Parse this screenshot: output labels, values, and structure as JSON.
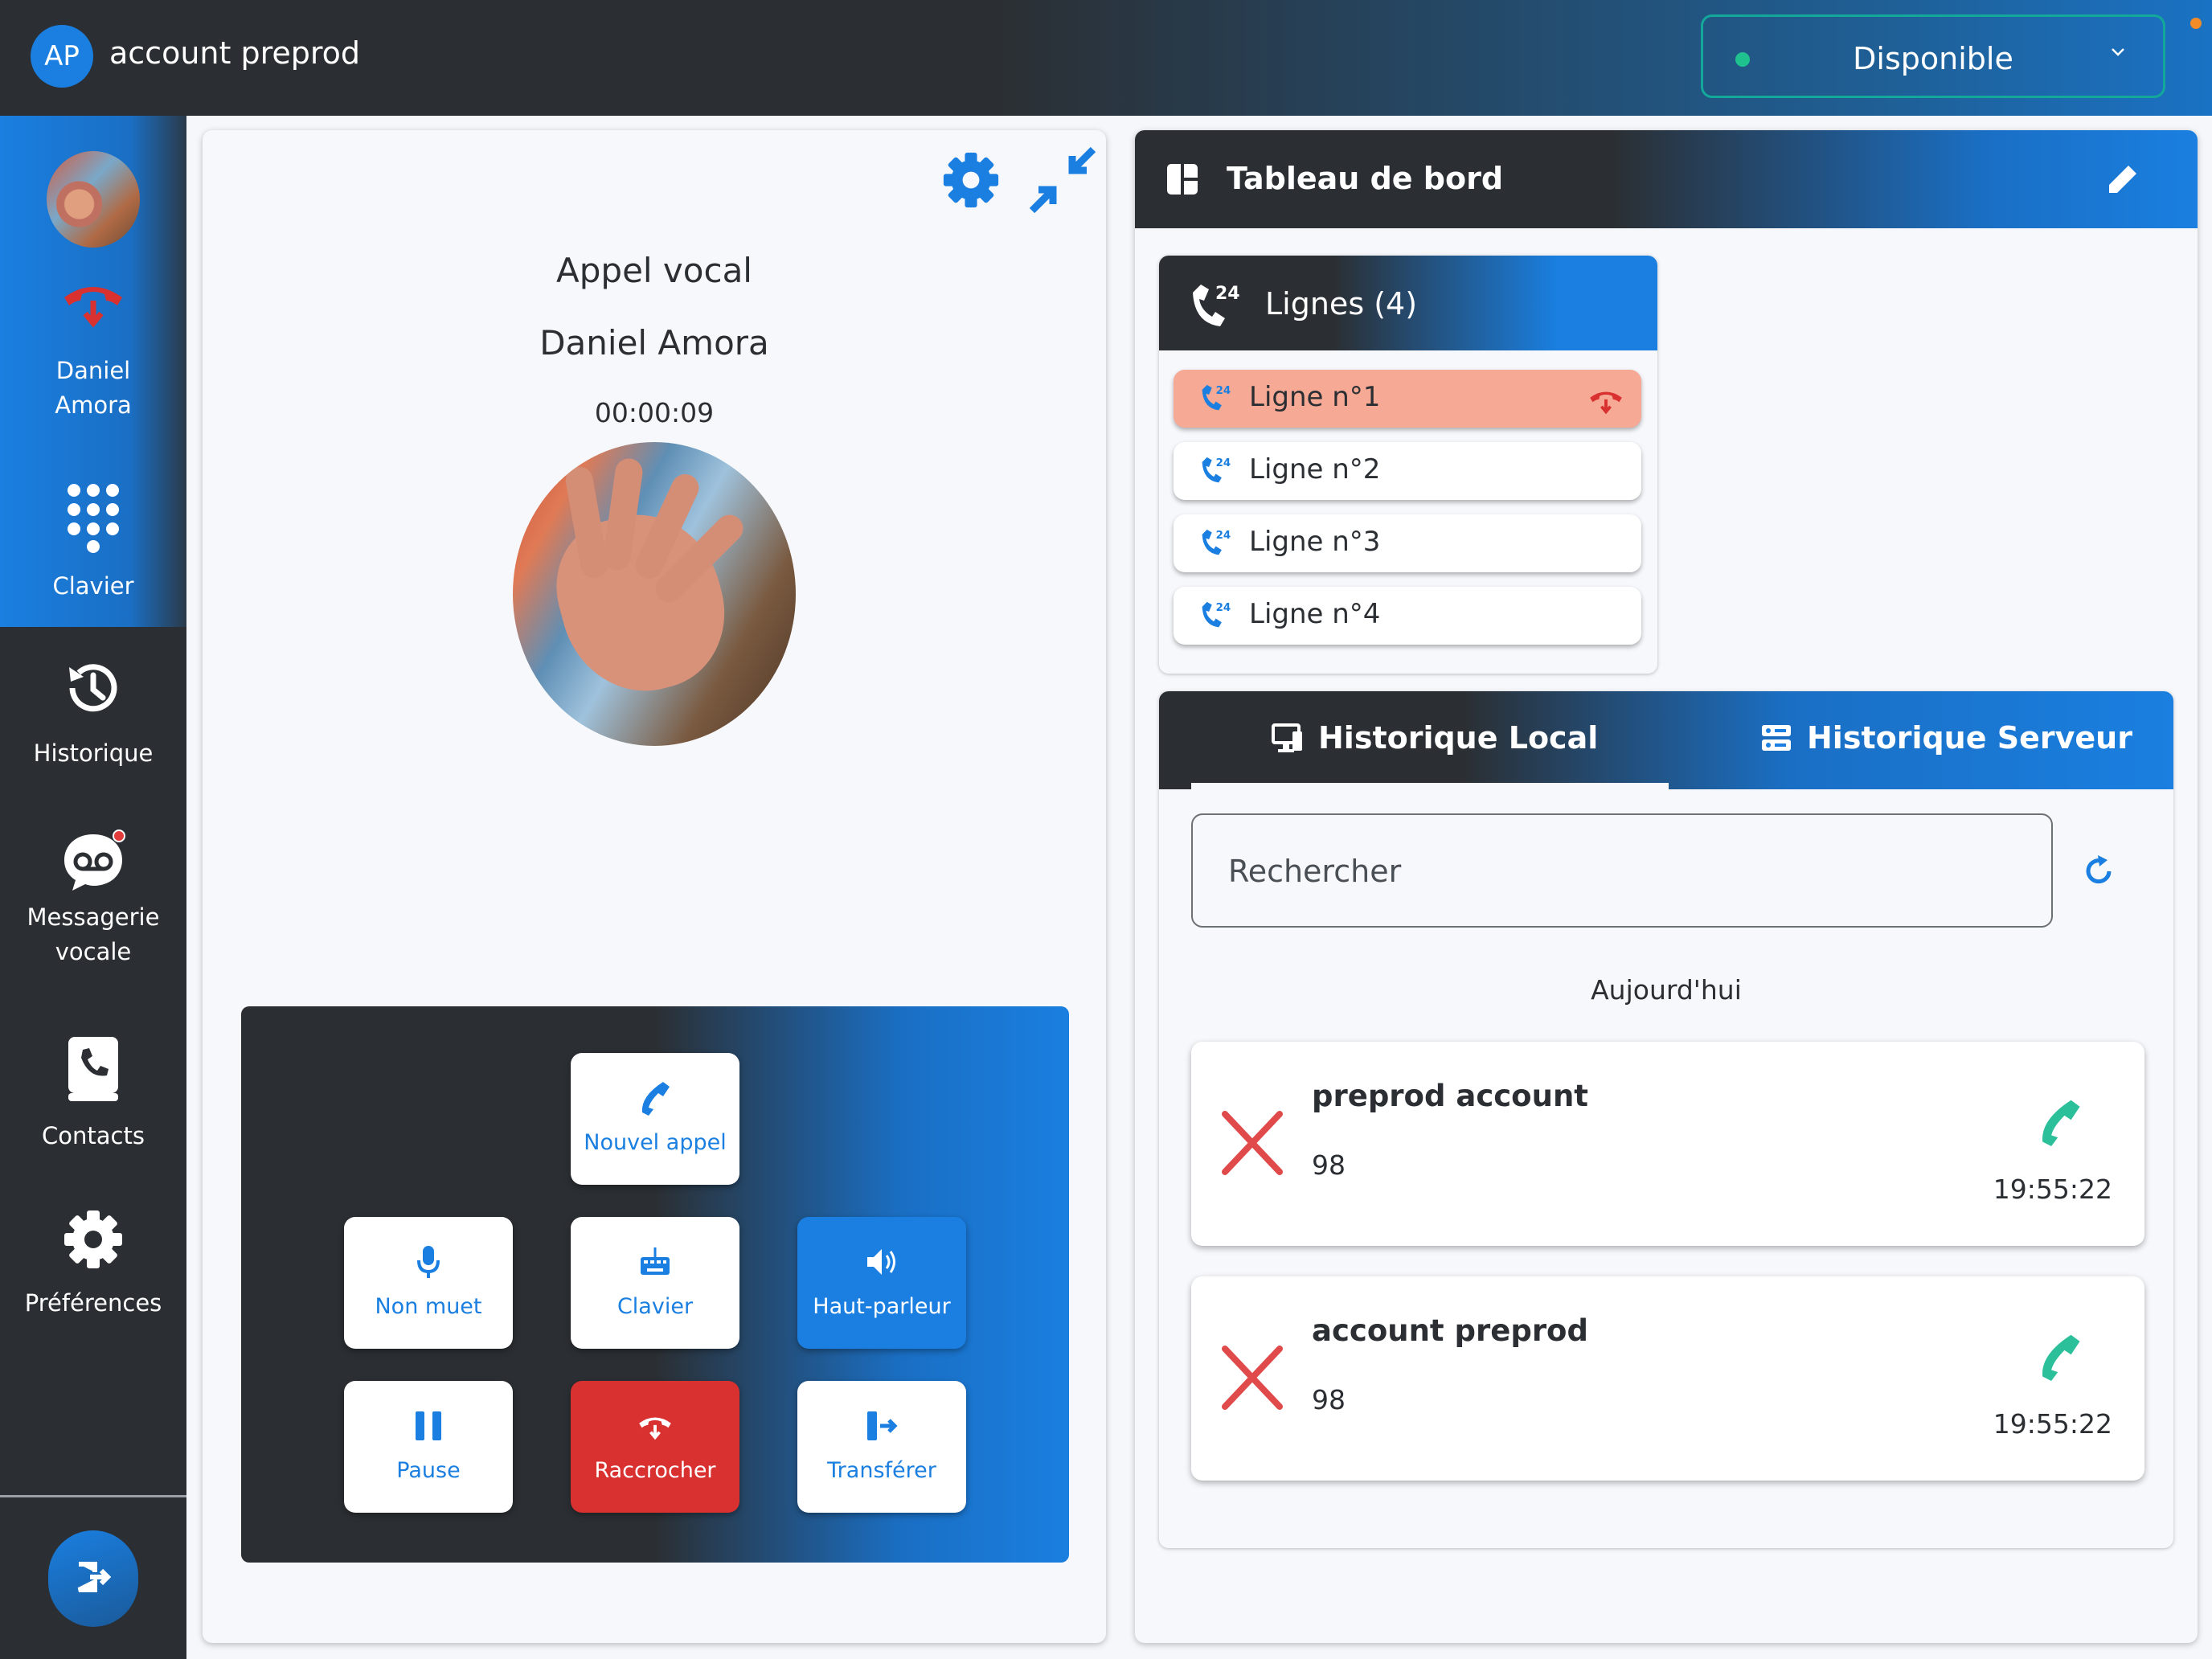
{
  "header": {
    "avatar_initials": "AP",
    "account_name": "account preprod",
    "status": {
      "selected": "Disponible",
      "dot_color": "#1fc28f"
    }
  },
  "sidebar": {
    "active_call": {
      "label_line1": "Daniel",
      "label_line2": "Amora"
    },
    "items": [
      {
        "id": "keypad",
        "label": "Clavier",
        "icon": "dialpad-icon"
      },
      {
        "id": "history",
        "label": "Historique",
        "icon": "history-icon"
      },
      {
        "id": "voicemail",
        "label_line1": "Messagerie",
        "label_line2": "vocale",
        "icon": "voicemail-icon"
      },
      {
        "id": "contacts",
        "label": "Contacts",
        "icon": "contacts-icon"
      },
      {
        "id": "preferences",
        "label": "Préférences",
        "icon": "gear-icon"
      }
    ],
    "logout_icon": "logout-icon"
  },
  "call": {
    "type": "Appel vocal",
    "contact_name": "Daniel Amora",
    "duration": "00:00:09",
    "buttons": {
      "new_call": "Nouvel appel",
      "mute": "Non muet",
      "keypad": "Clavier",
      "speaker": "Haut-parleur",
      "hold": "Pause",
      "hangup": "Raccrocher",
      "transfer": "Transférer"
    },
    "colors": {
      "accent": "#1a7fe0",
      "hangup": "#d93030"
    }
  },
  "dashboard": {
    "title": "Tableau de bord",
    "lines": {
      "title": "Lignes (4)",
      "items": [
        {
          "label": "Ligne n°1",
          "active": true
        },
        {
          "label": "Ligne n°2",
          "active": false
        },
        {
          "label": "Ligne n°3",
          "active": false
        },
        {
          "label": "Ligne n°4",
          "active": false
        }
      ]
    },
    "history": {
      "tabs": [
        "Historique Local",
        "Historique Serveur"
      ],
      "active_tab": "Historique Local",
      "search_placeholder": "Rechercher",
      "day_label": "Aujourd'hui",
      "entries": [
        {
          "name": "preprod account",
          "number": "98",
          "time": "19:55:22",
          "status": "missed"
        },
        {
          "name": "account preprod",
          "number": "98",
          "time": "19:55:22",
          "status": "missed"
        }
      ]
    }
  }
}
